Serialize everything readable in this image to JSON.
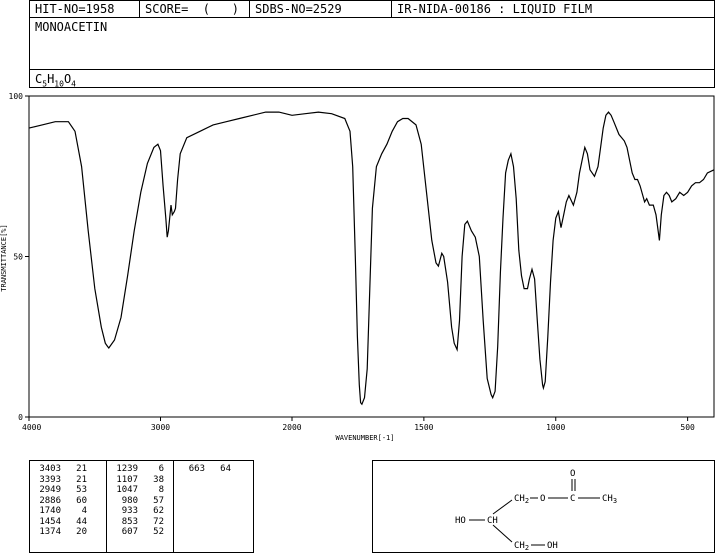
{
  "header": {
    "hit_no": "HIT-NO=1958",
    "score": "SCORE=  (   )",
    "sdbs_no": "SDBS-NO=2529",
    "ir_id": "IR-NIDA-00186 : LIQUID FILM",
    "compound_name": "MONOACETIN",
    "formula_c": "C",
    "formula_c_sub": "5",
    "formula_h": "H",
    "formula_h_sub": "10",
    "formula_o": "O",
    "formula_o_sub": "4"
  },
  "chart_data": {
    "type": "line",
    "xlabel": "WAVENUMBER[-1]",
    "ylabel": "TRANSMITTANCE[%]",
    "xlim": [
      4000,
      400
    ],
    "ylim": [
      0,
      100
    ],
    "x_tick_labels": [
      "4000",
      "3000",
      "2000",
      "1500",
      "1000",
      "500"
    ],
    "y_tick_labels": [
      "100",
      "50",
      "0"
    ],
    "x_ticks": [
      4000,
      3000,
      2000,
      1500,
      1000,
      500
    ],
    "y_ticks": [
      100,
      50,
      0
    ],
    "grid": false,
    "series": [
      {
        "color": "#000000",
        "points": [
          [
            4000,
            90
          ],
          [
            3900,
            91
          ],
          [
            3800,
            92
          ],
          [
            3700,
            92
          ],
          [
            3650,
            89
          ],
          [
            3600,
            78
          ],
          [
            3550,
            58
          ],
          [
            3500,
            40
          ],
          [
            3450,
            28
          ],
          [
            3420,
            23
          ],
          [
            3403,
            22
          ],
          [
            3393,
            21.5
          ],
          [
            3350,
            24
          ],
          [
            3300,
            31
          ],
          [
            3250,
            44
          ],
          [
            3200,
            58
          ],
          [
            3150,
            70
          ],
          [
            3100,
            79
          ],
          [
            3050,
            84
          ],
          [
            3020,
            85
          ],
          [
            3000,
            83
          ],
          [
            2980,
            72
          ],
          [
            2960,
            62
          ],
          [
            2949,
            56
          ],
          [
            2940,
            58
          ],
          [
            2920,
            66
          ],
          [
            2910,
            63
          ],
          [
            2895,
            64
          ],
          [
            2886,
            65
          ],
          [
            2870,
            74
          ],
          [
            2850,
            82
          ],
          [
            2800,
            87
          ],
          [
            2700,
            89
          ],
          [
            2600,
            91
          ],
          [
            2500,
            92
          ],
          [
            2400,
            93
          ],
          [
            2300,
            94
          ],
          [
            2200,
            95
          ],
          [
            2100,
            95
          ],
          [
            2000,
            94
          ],
          [
            1950,
            94.5
          ],
          [
            1900,
            95
          ],
          [
            1850,
            94.5
          ],
          [
            1800,
            93
          ],
          [
            1780,
            89
          ],
          [
            1770,
            78
          ],
          [
            1760,
            50
          ],
          [
            1752,
            25
          ],
          [
            1745,
            10
          ],
          [
            1740,
            4.5
          ],
          [
            1735,
            4
          ],
          [
            1725,
            6
          ],
          [
            1715,
            15
          ],
          [
            1705,
            40
          ],
          [
            1695,
            65
          ],
          [
            1680,
            78
          ],
          [
            1660,
            82
          ],
          [
            1640,
            85
          ],
          [
            1620,
            89
          ],
          [
            1600,
            92
          ],
          [
            1580,
            93
          ],
          [
            1560,
            93
          ],
          [
            1530,
            91
          ],
          [
            1510,
            85
          ],
          [
            1490,
            70
          ],
          [
            1470,
            55
          ],
          [
            1454,
            48
          ],
          [
            1445,
            47
          ],
          [
            1432,
            51
          ],
          [
            1425,
            50
          ],
          [
            1410,
            42
          ],
          [
            1395,
            28
          ],
          [
            1385,
            23
          ],
          [
            1374,
            21
          ],
          [
            1365,
            30
          ],
          [
            1355,
            50
          ],
          [
            1345,
            60
          ],
          [
            1335,
            61
          ],
          [
            1320,
            58
          ],
          [
            1305,
            56
          ],
          [
            1290,
            50
          ],
          [
            1275,
            30
          ],
          [
            1260,
            12
          ],
          [
            1245,
            7
          ],
          [
            1239,
            6
          ],
          [
            1230,
            8
          ],
          [
            1220,
            22
          ],
          [
            1210,
            45
          ],
          [
            1200,
            62
          ],
          [
            1190,
            76
          ],
          [
            1180,
            80
          ],
          [
            1170,
            82
          ],
          [
            1160,
            78
          ],
          [
            1150,
            68
          ],
          [
            1140,
            52
          ],
          [
            1130,
            44
          ],
          [
            1120,
            40
          ],
          [
            1107,
            40
          ],
          [
            1100,
            43
          ],
          [
            1090,
            46
          ],
          [
            1080,
            43
          ],
          [
            1070,
            30
          ],
          [
            1060,
            18
          ],
          [
            1050,
            10
          ],
          [
            1047,
            9
          ],
          [
            1040,
            11
          ],
          [
            1030,
            25
          ],
          [
            1020,
            42
          ],
          [
            1010,
            55
          ],
          [
            1000,
            62
          ],
          [
            990,
            64
          ],
          [
            980,
            59
          ],
          [
            970,
            63
          ],
          [
            960,
            67
          ],
          [
            950,
            69
          ],
          [
            933,
            66
          ],
          [
            920,
            70
          ],
          [
            910,
            76
          ],
          [
            900,
            80
          ],
          [
            890,
            84
          ],
          [
            880,
            82
          ],
          [
            870,
            77
          ],
          [
            853,
            75
          ],
          [
            840,
            78
          ],
          [
            830,
            84
          ],
          [
            820,
            90
          ],
          [
            810,
            94
          ],
          [
            800,
            95
          ],
          [
            790,
            94
          ],
          [
            780,
            92
          ],
          [
            770,
            90
          ],
          [
            760,
            88
          ],
          [
            750,
            87
          ],
          [
            740,
            86
          ],
          [
            730,
            84
          ],
          [
            720,
            80
          ],
          [
            710,
            76
          ],
          [
            700,
            74
          ],
          [
            690,
            74
          ],
          [
            680,
            72
          ],
          [
            670,
            69
          ],
          [
            663,
            67
          ],
          [
            655,
            68
          ],
          [
            645,
            66
          ],
          [
            630,
            66
          ],
          [
            620,
            63
          ],
          [
            607,
            55
          ],
          [
            600,
            63
          ],
          [
            590,
            69
          ],
          [
            580,
            70
          ],
          [
            570,
            69
          ],
          [
            560,
            67
          ],
          [
            545,
            68
          ],
          [
            530,
            70
          ],
          [
            515,
            69
          ],
          [
            500,
            70
          ],
          [
            485,
            72
          ],
          [
            470,
            73
          ],
          [
            455,
            73
          ],
          [
            440,
            74
          ],
          [
            425,
            76
          ],
          [
            400,
            77
          ]
        ]
      }
    ]
  },
  "peak_table": {
    "columns": [
      [
        [
          "3403",
          "21"
        ],
        [
          "3393",
          "21"
        ],
        [
          "2949",
          "53"
        ],
        [
          "2886",
          "60"
        ],
        [
          "1740",
          "4"
        ],
        [
          "1454",
          "44"
        ],
        [
          "1374",
          "20"
        ]
      ],
      [
        [
          "1239",
          "6"
        ],
        [
          "1107",
          "38"
        ],
        [
          "1047",
          "8"
        ],
        [
          "980",
          "57"
        ],
        [
          "933",
          "62"
        ],
        [
          "853",
          "72"
        ],
        [
          "607",
          "52"
        ]
      ],
      [
        [
          "663",
          "64"
        ]
      ]
    ]
  },
  "structure": {
    "ho_left": "HO",
    "ch_center": "CH",
    "ch2_top": "CH",
    "ch2_top_sub": "2",
    "o_ester": "O",
    "c_carbonyl": "C",
    "o_carbonyl": "O",
    "ch3": "CH",
    "ch3_sub": "3",
    "ch2_bottom": "CH",
    "ch2_bottom_sub": "2",
    "oh_bottom": "OH"
  }
}
